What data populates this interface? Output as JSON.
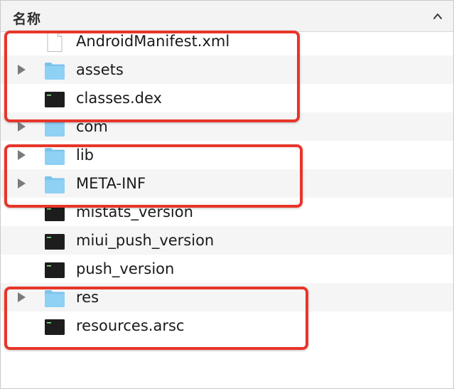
{
  "header": {
    "column_name": "名称",
    "sort_icon": "chevron-up-icon"
  },
  "files": [
    {
      "name": "AndroidManifest.xml",
      "kind": "document",
      "expandable": false
    },
    {
      "name": "assets",
      "kind": "folder",
      "expandable": true
    },
    {
      "name": "classes.dex",
      "kind": "executable",
      "expandable": false
    },
    {
      "name": "com",
      "kind": "folder",
      "expandable": true
    },
    {
      "name": "lib",
      "kind": "folder",
      "expandable": true
    },
    {
      "name": "META-INF",
      "kind": "folder",
      "expandable": true
    },
    {
      "name": "mistats_version",
      "kind": "executable",
      "expandable": false
    },
    {
      "name": "miui_push_version",
      "kind": "executable",
      "expandable": false
    },
    {
      "name": "push_version",
      "kind": "executable",
      "expandable": false
    },
    {
      "name": "res",
      "kind": "folder",
      "expandable": true
    },
    {
      "name": "resources.arsc",
      "kind": "executable",
      "expandable": false
    }
  ],
  "highlights": [
    {
      "rows": [
        "AndroidManifest.xml",
        "assets",
        "classes.dex"
      ],
      "color": "#e8352a"
    },
    {
      "rows": [
        "lib",
        "META-INF"
      ],
      "color": "#e8352a"
    },
    {
      "rows": [
        "res",
        "resources.arsc"
      ],
      "color": "#e8352a"
    }
  ],
  "colors": {
    "folder": "#8fd0f5",
    "folder_tab": "#7cc3ec",
    "executable": "#1d1d1d",
    "highlight": "#e8352a",
    "stripe": "#f5f5f5"
  }
}
